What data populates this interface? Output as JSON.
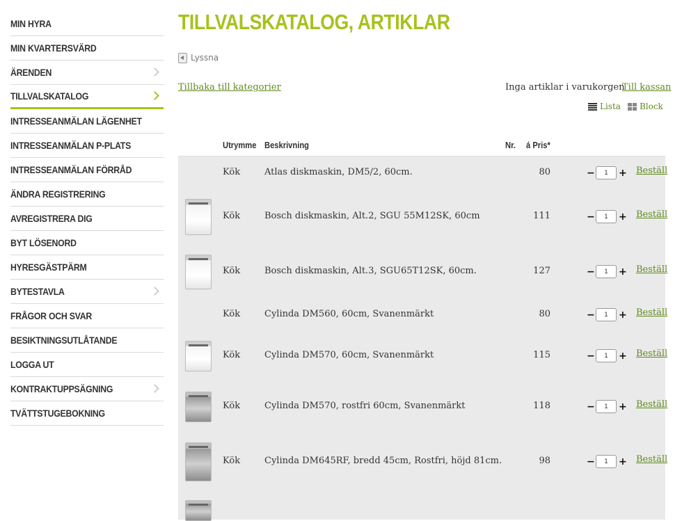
{
  "sidebar": {
    "items": [
      {
        "label": "MIN HYRA",
        "chevron": false,
        "active": false
      },
      {
        "label": "MIN KVARTERSVÄRD",
        "chevron": false,
        "active": false
      },
      {
        "label": "ÄRENDEN",
        "chevron": true,
        "active": false
      },
      {
        "label": "TILLVALSKATALOG",
        "chevron": true,
        "active": true
      },
      {
        "label": "INTRESSEANMÄLAN LÄGENHET",
        "chevron": false,
        "active": false
      },
      {
        "label": "INTRESSEANMÄLAN P-PLATS",
        "chevron": false,
        "active": false
      },
      {
        "label": "INTRESSEANMÄLAN FÖRRÅD",
        "chevron": false,
        "active": false
      },
      {
        "label": "ÄNDRA REGISTRERING",
        "chevron": false,
        "active": false
      },
      {
        "label": "AVREGISTRERA DIG",
        "chevron": false,
        "active": false
      },
      {
        "label": "BYT LÖSENORD",
        "chevron": false,
        "active": false
      },
      {
        "label": "HYRESGÄSTPÄRM",
        "chevron": false,
        "active": false
      },
      {
        "label": "BYTESTAVLA",
        "chevron": true,
        "active": false
      },
      {
        "label": "FRÅGOR OCH SVAR",
        "chevron": false,
        "active": false
      },
      {
        "label": "BESIKTNINGSUTLÅTANDE",
        "chevron": false,
        "active": false
      },
      {
        "label": "LOGGA UT",
        "chevron": false,
        "active": false
      },
      {
        "label": "KONTRAKTUPPSÄGNING",
        "chevron": true,
        "active": false
      },
      {
        "label": "TVÄTTSTUGEBOKNING",
        "chevron": false,
        "active": false
      }
    ]
  },
  "main": {
    "title": "TILLVALSKATALOG, ARTIKLAR",
    "listen_label": "Lyssna",
    "back_link": "Tillbaka till kategorier",
    "cart_status": "Inga artiklar i varukorgen",
    "checkout_link": "Till kassan",
    "view_list": "Lista",
    "view_block": "Block"
  },
  "table": {
    "columns": {
      "room": "Utrymme",
      "description": "Beskrivning",
      "nr": "Nr.",
      "price": "á Pris*"
    },
    "order_label": "Beställ",
    "minus": "−",
    "plus": "+",
    "rows": [
      {
        "room": "Kök",
        "description": "Atlas diskmaskin, DM5/2, 60cm.",
        "nr": "",
        "price": "80",
        "qty": "1",
        "image": "none"
      },
      {
        "room": "Kök",
        "description": "Bosch diskmaskin, Alt.2, SGU 55M12SK, 60cm",
        "nr": "",
        "price": "111",
        "qty": "1",
        "image": "white"
      },
      {
        "room": "Kök",
        "description": "Bosch diskmaskin, Alt.3, SGU65T12SK, 60cm.",
        "nr": "",
        "price": "127",
        "qty": "1",
        "image": "white"
      },
      {
        "room": "Kök",
        "description": "Cylinda DM560, 60cm, Svanenmärkt",
        "nr": "",
        "price": "80",
        "qty": "1",
        "image": "none"
      },
      {
        "room": "Kök",
        "description": "Cylinda DM570, 60cm, Svanenmärkt",
        "nr": "",
        "price": "115",
        "qty": "1",
        "image": "white"
      },
      {
        "room": "Kök",
        "description": "Cylinda DM570, rostfri 60cm, Svanenmärkt",
        "nr": "",
        "price": "118",
        "qty": "1",
        "image": "steel"
      },
      {
        "room": "Kök",
        "description": "Cylinda DM645RF, bredd 45cm, Rostfri, höjd 81cm.",
        "nr": "",
        "price": "98",
        "qty": "1",
        "image": "steel"
      },
      {
        "room": "",
        "description": "",
        "nr": "",
        "price": "",
        "qty": "",
        "image": "steel"
      }
    ]
  },
  "colors": {
    "accent": "#a6c21c",
    "link": "#5f8a1c",
    "row_bg": "#eaeaea"
  }
}
